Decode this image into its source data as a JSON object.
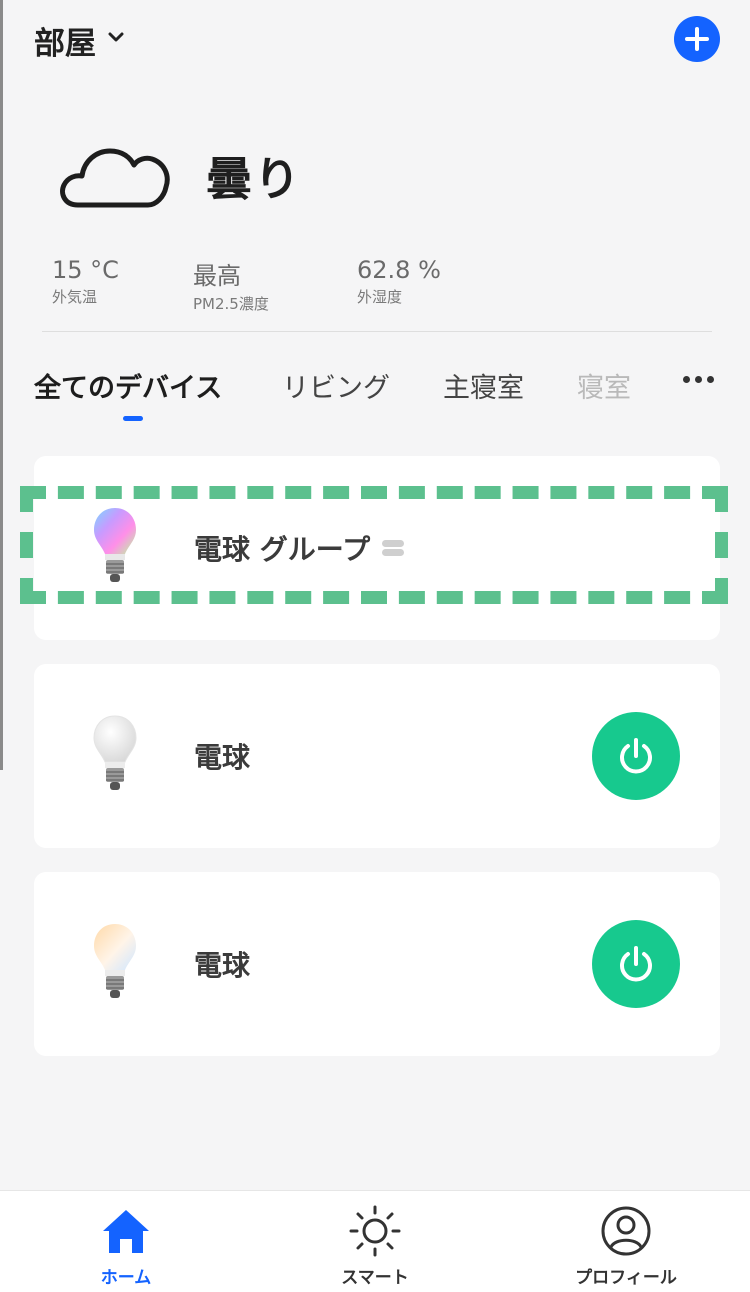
{
  "header": {
    "room_title": "部屋"
  },
  "weather": {
    "condition": "曇り",
    "stats": [
      {
        "value": "15 °C",
        "label": "外気温"
      },
      {
        "value": "最高",
        "label": "PM2.5濃度"
      },
      {
        "value": "62.8 %",
        "label": "外湿度"
      }
    ]
  },
  "tabs": [
    {
      "label": "全てのデバイス",
      "active": true
    },
    {
      "label": "リビング"
    },
    {
      "label": "主寝室"
    },
    {
      "label": "寝室"
    }
  ],
  "devices": [
    {
      "name": "電球 グループ",
      "icon": "rgb-bulb-icon",
      "is_group": true
    },
    {
      "name": "電球",
      "icon": "white-bulb-icon",
      "power": "on"
    },
    {
      "name": "電球",
      "icon": "tunable-bulb-icon",
      "power": "on"
    }
  ],
  "bottom_nav": [
    {
      "label": "ホーム",
      "icon": "home-icon",
      "active": true
    },
    {
      "label": "スマート",
      "icon": "sun-icon"
    },
    {
      "label": "プロフィール",
      "icon": "profile-icon"
    }
  ],
  "colors": {
    "accent": "#1463ff",
    "power": "#17c98e",
    "highlight": "#5cc08e",
    "background": "#f5f5f6"
  }
}
